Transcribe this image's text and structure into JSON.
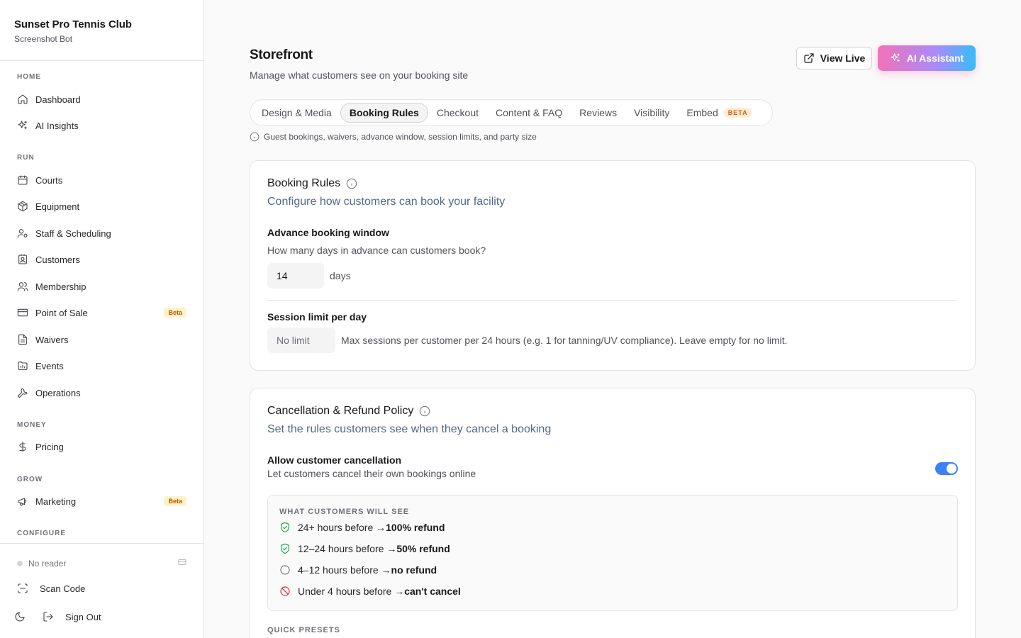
{
  "sidebar": {
    "org_name": "Sunset Pro Tennis Club",
    "org_sub": "Screenshot Bot",
    "sections": {
      "home": "HOME",
      "run": "RUN",
      "money": "MONEY",
      "grow": "GROW",
      "configure": "CONFIGURE"
    },
    "items": {
      "dashboard": "Dashboard",
      "ai_insights": "AI Insights",
      "courts": "Courts",
      "equipment": "Equipment",
      "staff": "Staff & Scheduling",
      "customers": "Customers",
      "membership": "Membership",
      "pos": "Point of Sale",
      "waivers": "Waivers",
      "events": "Events",
      "operations": "Operations",
      "pricing": "Pricing",
      "marketing": "Marketing"
    },
    "beta_badge": "Beta",
    "reader_status": "No reader",
    "scan_code": "Scan Code",
    "sign_out": "Sign Out"
  },
  "header": {
    "title": "Storefront",
    "subtitle": "Manage what customers see on your booking site",
    "view_live": "View Live",
    "ai_assistant": "AI Assistant"
  },
  "tabs": {
    "design": "Design & Media",
    "booking": "Booking Rules",
    "checkout": "Checkout",
    "content": "Content & FAQ",
    "reviews": "Reviews",
    "visibility": "Visibility",
    "embed": "Embed",
    "embed_badge": "BETA",
    "hint": "Guest bookings, waivers, advance window, session limits, and party size"
  },
  "booking_rules": {
    "title": "Booking Rules",
    "description": "Configure how customers can book your facility",
    "advance_label": "Advance booking window",
    "advance_help": "How many days in advance can customers book?",
    "advance_value": "14",
    "advance_suffix": "days",
    "session_label": "Session limit per day",
    "session_placeholder": "No limit",
    "session_help": "Max sessions per customer per 24 hours (e.g. 1 for tanning/UV compliance). Leave empty for no limit."
  },
  "cancellation": {
    "title": "Cancellation & Refund Policy",
    "description": "Set the rules customers see when they cancel a booking",
    "allow_label": "Allow customer cancellation",
    "allow_help": "Let customers cancel their own bookings online",
    "allow_enabled": true,
    "preview_head": "WHAT CUSTOMERS WILL SEE",
    "rules": [
      {
        "when": "24+ hours before → ",
        "result": "100% refund",
        "icon": "shield-check-icon",
        "color": "#16a34a"
      },
      {
        "when": "12–24 hours before → ",
        "result": "50% refund",
        "icon": "shield-check-icon",
        "color": "#16a34a"
      },
      {
        "when": "4–12 hours before → ",
        "result": "no refund",
        "icon": "circle-icon",
        "color": "#71717a"
      },
      {
        "when": "Under 4 hours before → ",
        "result": "can't cancel",
        "icon": "ban-icon",
        "color": "#dc2626"
      }
    ],
    "presets_label": "QUICK PRESETS"
  },
  "colors": {
    "accent": "#3b82f6",
    "ai_gradient_start": "#f472b6",
    "ai_gradient_end": "#38bdf8",
    "beta_badge_bg": "#fef3c7",
    "beta_badge_fg": "#b45309"
  }
}
